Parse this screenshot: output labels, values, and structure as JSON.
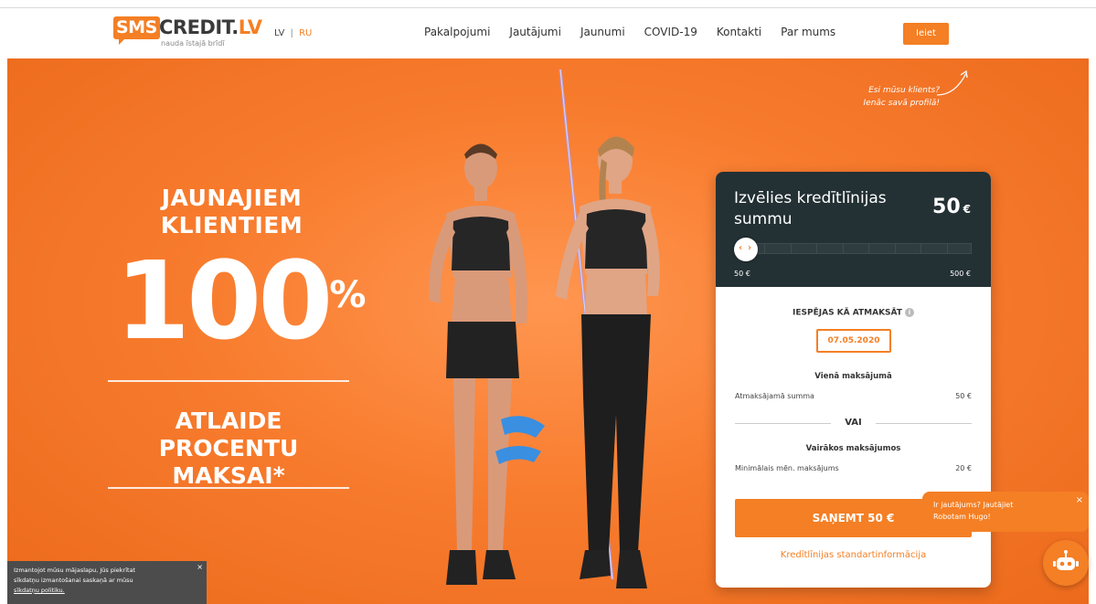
{
  "header": {
    "logo_sms": "SMS",
    "logo_credit": "CREDIT.",
    "logo_lv": "LV",
    "logo_tagline": "nauda īstajā brīdī",
    "lang_lv": "LV",
    "lang_separator": "|",
    "lang_ru": "RU",
    "nav": [
      "Pakalpojumi",
      "Jautājumi",
      "Jaunumi",
      "COVID-19",
      "Kontakti",
      "Par mums"
    ],
    "login_label": "Ieiet"
  },
  "hero": {
    "line1a": "JAUNAJIEM",
    "line1b": "KLIENTIEM",
    "big_number": "100",
    "big_percent": "%",
    "line2a": "ATLAIDE",
    "line2b": "PROCENTU MAKSAI*",
    "client_note_1": "Esi mūsu klients?",
    "client_note_2": "Ienāc savā profilā!"
  },
  "calculator": {
    "title": "Izvēlies kredītlīnijas summu",
    "amount": "50",
    "currency": "€",
    "slider_min_label": "50 €",
    "slider_max_label": "500 €",
    "slider_value": 0,
    "repay_title": "IESPĒJAS KĀ ATMAKSĀT",
    "info_icon": "i",
    "date": "07.05.2020",
    "single_title": "Vienā maksājumā",
    "single_label": "Atmaksājamā summa",
    "single_value": "50 €",
    "or_label": "VAI",
    "multi_title": "Vairākos maksājumos",
    "multi_label": "Minimālais mēn. maksājums",
    "multi_value": "20 €",
    "cta_label": "SAŅEMT 50 €",
    "info_link": "Kredītlīnijas standartinformācija"
  },
  "chat": {
    "line1": "Ir jautājums? Jautājiet",
    "line2": "Robotam Hugo!",
    "close": "×",
    "icon": "robot-icon"
  },
  "cookie": {
    "line1": "Izmantojot mūsu mājaslapu, Jūs piekrītat",
    "line2": "sīkdatņu izmantošanai saskaņā ar mūsu",
    "link": "sīkdatņu politiku.",
    "close": "×"
  },
  "colors": {
    "accent": "#f47f24",
    "panel_dark": "#233034"
  }
}
